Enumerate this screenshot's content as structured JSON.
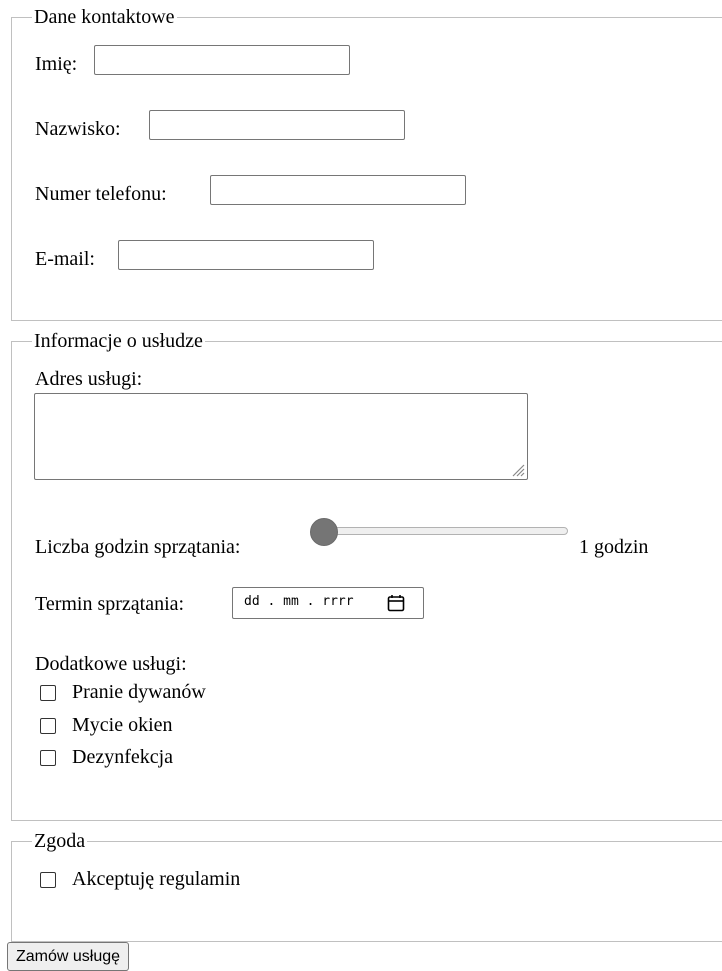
{
  "contact": {
    "legend": "Dane kontaktowe",
    "first_name_label": "Imię:",
    "first_name_value": "",
    "last_name_label": "Nazwisko:",
    "last_name_value": "",
    "phone_label": "Numer telefonu:",
    "phone_value": "",
    "email_label": "E-mail:",
    "email_value": ""
  },
  "service": {
    "legend": "Informacje o usłudze",
    "address_label": "Adres usługi:",
    "address_value": "",
    "hours_label": "Liczba godzin sprzątania:",
    "hours_value": 1,
    "hours_min": 1,
    "hours_output": "1 godzin",
    "date_label": "Termin sprzątania:",
    "date_placeholder": "dd . mm . rrrr",
    "extras_label": "Dodatkowe usługi:",
    "extras": [
      {
        "label": "Pranie dywanów",
        "checked": false
      },
      {
        "label": "Mycie okien",
        "checked": false
      },
      {
        "label": "Dezynfekcja",
        "checked": false
      }
    ]
  },
  "consent": {
    "legend": "Zgoda",
    "accept_label": "Akceptuję regulamin",
    "accept_checked": false
  },
  "submit_label": "Zamów usługę",
  "icons": {
    "calendar": "calendar-icon",
    "resize_grip": "resize-grip-icon"
  }
}
